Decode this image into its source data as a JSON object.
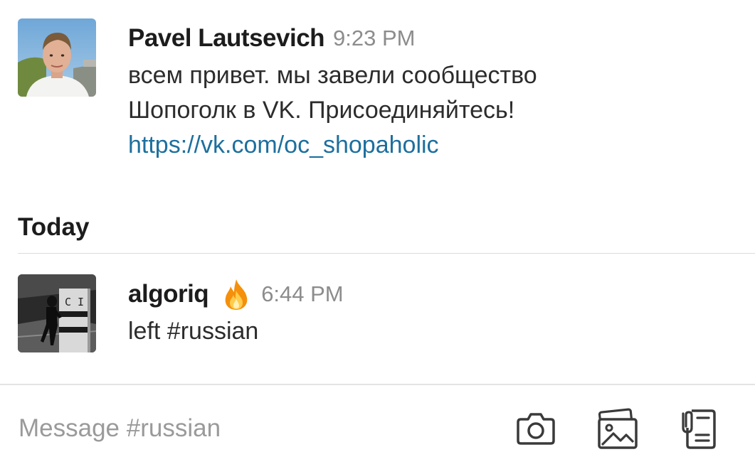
{
  "messages": [
    {
      "author": "Pavel Lautsevich",
      "time": "9:23 PM",
      "text_lines": [
        "всем привет. мы завели сообщество",
        "Шопоголк в VK. Присоединяйтесь!"
      ],
      "link": "https://vk.com/oc_shopaholic"
    },
    {
      "author": "algoriq",
      "status_emoji": "fire-icon",
      "time": "6:44 PM",
      "text": "left #russian"
    }
  ],
  "day_divider": {
    "label": "Today"
  },
  "composer": {
    "placeholder": "Message #russian",
    "value": "",
    "actions": [
      "camera-icon",
      "image-icon",
      "file-icon"
    ]
  },
  "colors": {
    "link": "#1d6f9e",
    "timestamp": "#8c8c8c",
    "divider": "#dcdcdc"
  }
}
